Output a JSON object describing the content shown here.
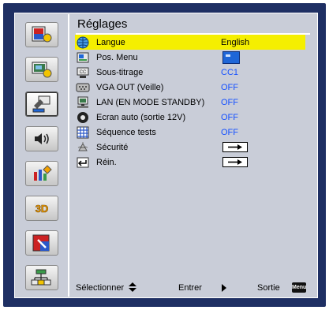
{
  "menu": {
    "title": "Réglages",
    "items": [
      {
        "icon": "globe-icon",
        "label": "Langue",
        "value": "English",
        "type": "text",
        "selected": true
      },
      {
        "icon": "menu-position-icon",
        "label": "Pos. Menu",
        "value": "",
        "type": "menupos",
        "selected": false
      },
      {
        "icon": "caption-icon",
        "label": "Sous-titrage",
        "value": "CC1",
        "type": "text",
        "selected": false
      },
      {
        "icon": "vga-out-icon",
        "label": "VGA OUT (Veille)",
        "value": "OFF",
        "type": "text",
        "selected": false
      },
      {
        "icon": "lan-icon",
        "label": "LAN (EN MODE STANDBY)",
        "value": "OFF",
        "type": "text",
        "selected": false
      },
      {
        "icon": "screen-auto-icon",
        "label": "Ecran auto (sortie 12V)",
        "value": "OFF",
        "type": "text",
        "selected": false
      },
      {
        "icon": "test-pattern-icon",
        "label": "Séquence tests",
        "value": "OFF",
        "type": "text",
        "selected": false
      },
      {
        "icon": "security-icon",
        "label": "Sécurité",
        "value": "",
        "type": "arrow",
        "selected": false
      },
      {
        "icon": "reset-icon",
        "label": "Réin.",
        "value": "",
        "type": "arrow",
        "selected": false
      }
    ]
  },
  "sidebar": {
    "items": [
      {
        "name": "sidebar-item-image",
        "icon": "image-settings-icon",
        "active": false
      },
      {
        "name": "sidebar-item-display",
        "icon": "display-settings-icon",
        "active": false
      },
      {
        "name": "sidebar-item-setup",
        "icon": "setup-settings-icon",
        "active": true
      },
      {
        "name": "sidebar-item-volume",
        "icon": "speaker-volume-icon",
        "active": false
      },
      {
        "name": "sidebar-item-options",
        "icon": "options-icon",
        "active": false
      },
      {
        "name": "sidebar-item-3d",
        "icon": "3d-icon",
        "label": "3D",
        "active": false
      },
      {
        "name": "sidebar-item-interactive",
        "icon": "interactive-pen-icon",
        "active": false
      },
      {
        "name": "sidebar-item-network",
        "icon": "network-lan-icon",
        "active": false
      }
    ]
  },
  "footer": {
    "select_label": "Sélectionner",
    "enter_label": "Entrer",
    "exit_label": "Sortie",
    "menu_key_label": "Menu"
  },
  "colors": {
    "frame": "#1e2f63",
    "panel": "#c9cdd8",
    "highlight": "#f5ef00",
    "value_text": "#1450ff"
  }
}
